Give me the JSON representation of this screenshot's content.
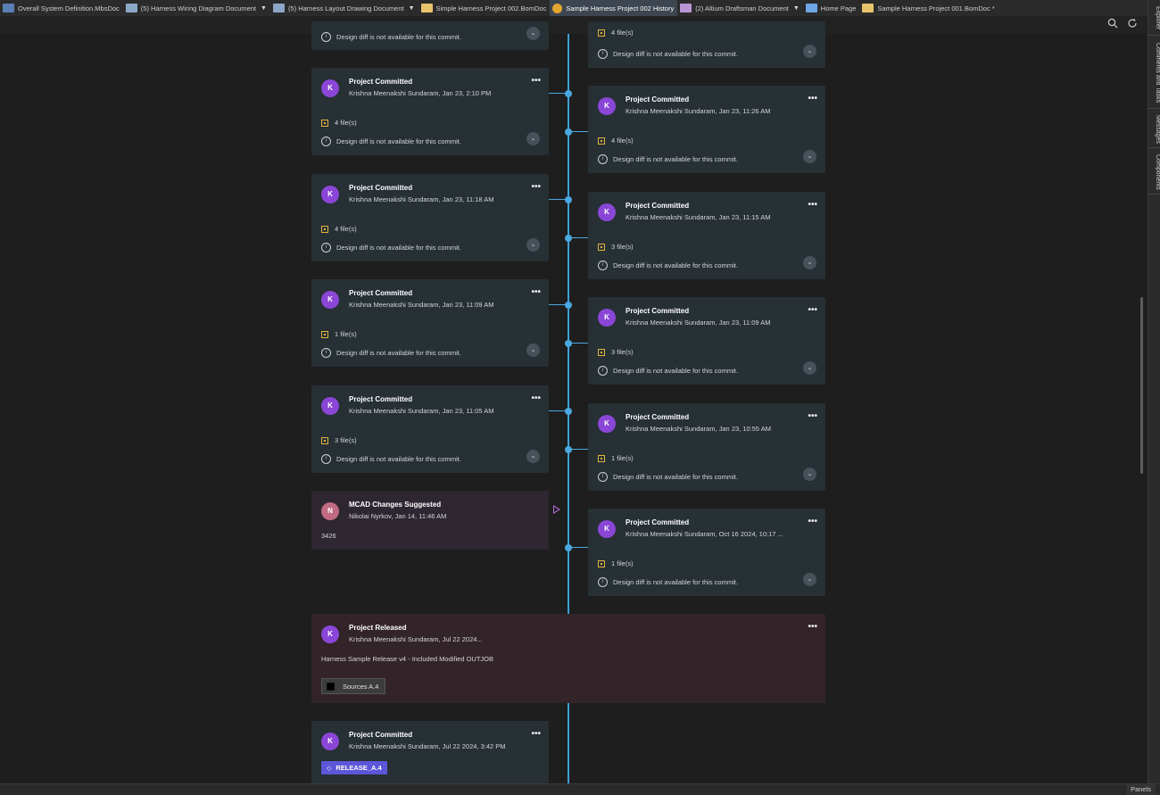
{
  "tabs": [
    {
      "label": "Overall System Definition.MbsDoc",
      "icon": "document-icon",
      "dropdown": false,
      "active": false
    },
    {
      "label": "(5) Harness Wiring Diagram Document",
      "icon": "wiring-diagram-icon",
      "dropdown": true,
      "active": false
    },
    {
      "label": "(5) Harness Layout Drawing Document",
      "icon": "layout-drawing-icon",
      "dropdown": true,
      "active": false
    },
    {
      "label": "Simple Harness Project 002.BomDoc",
      "icon": "bom-icon",
      "dropdown": false,
      "active": false
    },
    {
      "label": "Sample Harness Project 002 History",
      "icon": "history-icon",
      "dropdown": false,
      "active": true
    },
    {
      "label": "(2) Altium Draftsman Document",
      "icon": "draftsman-icon",
      "dropdown": true,
      "active": false
    },
    {
      "label": "Home Page",
      "icon": "home-icon",
      "dropdown": false,
      "active": false
    },
    {
      "label": "Sample Harness Project 001.BomDoc *",
      "icon": "bom-icon",
      "dropdown": false,
      "active": false
    }
  ],
  "side_panels": [
    "Explorer",
    "Comments and Tasks",
    "Messages",
    "Components"
  ],
  "status": {
    "panels_label": "Panels"
  },
  "colors": {
    "timeline": "#3e9fd8",
    "avatar": "#8a46d6",
    "release_tag": "#5c56d8",
    "file_icon": "#e3b53c"
  },
  "common": {
    "diff_note": "Design diff is not available for this commit.",
    "menu": "•••"
  },
  "left_cards": [
    {
      "top_partial": true,
      "note": "Design diff is not available for this commit."
    },
    {
      "avatar": "K",
      "title": "Project Committed",
      "sub": "Krishna Meenakshi Sundaram, Jan 23, 2:10 PM",
      "files": "4 file(s)"
    },
    {
      "avatar": "K",
      "title": "Project Committed",
      "sub": "Krishna Meenakshi Sundaram, Jan 23, 11:18 AM",
      "files": "4 file(s)"
    },
    {
      "avatar": "K",
      "title": "Project Committed",
      "sub": "Krishna Meenakshi Sundaram, Jan 23, 11:09 AM",
      "files": "1 file(s)"
    },
    {
      "avatar": "K",
      "title": "Project Committed",
      "sub": "Krishna Meenakshi Sundaram, Jan 23, 11:05 AM",
      "files": "3 file(s)"
    }
  ],
  "right_cards": [
    {
      "top_partial": true,
      "files": "4 file(s)",
      "note": "Design diff is not available for this commit."
    },
    {
      "avatar": "K",
      "title": "Project Committed",
      "sub": "Krishna Meenakshi Sundaram, Jan 23, 11:26 AM",
      "files": "4 file(s)"
    },
    {
      "avatar": "K",
      "title": "Project Committed",
      "sub": "Krishna Meenakshi Sundaram, Jan 23, 11:15 AM",
      "files": "3 file(s)"
    },
    {
      "avatar": "K",
      "title": "Project Committed",
      "sub": "Krishna Meenakshi Sundaram, Jan 23, 11:09 AM",
      "files": "3 file(s)"
    },
    {
      "avatar": "K",
      "title": "Project Committed",
      "sub": "Krishna Meenakshi Sundaram, Jan 23, 10:55 AM",
      "files": "1 file(s)"
    },
    {
      "avatar": "K",
      "title": "Project Committed",
      "sub": "Krishna Meenakshi Sundaram, Oct 16 2024, 10:17 ...",
      "files": "1 file(s)"
    }
  ],
  "suggestion": {
    "avatar": "N",
    "title": "MCAD Changes Suggested",
    "sub": "Nikolai Nyrkov, Jan 14, 11:46 AM",
    "body": "3426"
  },
  "release": {
    "avatar": "K",
    "title": "Project Released",
    "sub": "Krishna Meenakshi Sundaram, Jul 22 2024...",
    "body": "Harness Sample Release v4 - Included Modified OUTJOB",
    "chip": "Sources A.4"
  },
  "last_commit": {
    "avatar": "K",
    "title": "Project Committed",
    "sub": "Krishna Meenakshi Sundaram, Jul 22 2024, 3:42 PM",
    "tag": "RELEASE_A.4"
  }
}
